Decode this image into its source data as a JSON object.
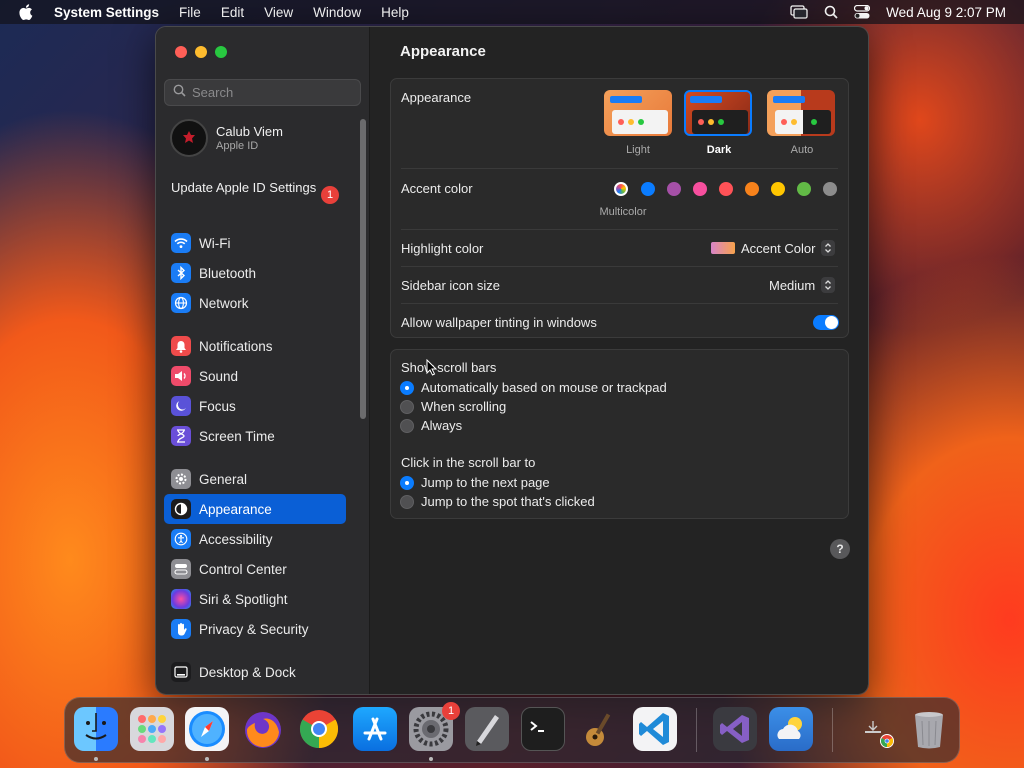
{
  "menubar": {
    "app_name": "System Settings",
    "items": [
      "File",
      "Edit",
      "View",
      "Window",
      "Help"
    ],
    "clock": "Wed Aug 9  2:07 PM"
  },
  "sidebar": {
    "search_placeholder": "Search",
    "user_name": "Calub Viem",
    "user_sub": "Apple ID",
    "update_label": "Update Apple ID Settings",
    "update_badge": "1",
    "items": [
      {
        "label": "Wi-Fi",
        "icon": "wifi-icon",
        "color": "#1a7cf5"
      },
      {
        "label": "Bluetooth",
        "icon": "bluetooth-icon",
        "color": "#1a7cf5"
      },
      {
        "label": "Network",
        "icon": "globe-icon",
        "color": "#1a7cf5"
      },
      {
        "label": "Notifications",
        "icon": "bell-icon",
        "color": "#ef4b4b"
      },
      {
        "label": "Sound",
        "icon": "speaker-icon",
        "color": "#ef4b6a"
      },
      {
        "label": "Focus",
        "icon": "moon-icon",
        "color": "#5a52d8"
      },
      {
        "label": "Screen Time",
        "icon": "hourglass-icon",
        "color": "#6a4fd8"
      },
      {
        "label": "General",
        "icon": "gear-icon",
        "color": "#8e8e93"
      },
      {
        "label": "Appearance",
        "icon": "appearance-icon",
        "color": "#1c1c1e"
      },
      {
        "label": "Accessibility",
        "icon": "accessibility-icon",
        "color": "#1a7cf5"
      },
      {
        "label": "Control Center",
        "icon": "control-center-icon",
        "color": "#8e8e93"
      },
      {
        "label": "Siri & Spotlight",
        "icon": "siri-icon",
        "color": "#b04aa8"
      },
      {
        "label": "Privacy & Security",
        "icon": "hand-icon",
        "color": "#1a7cf5"
      },
      {
        "label": "Desktop & Dock",
        "icon": "desktop-icon",
        "color": "#1c1c1e"
      }
    ]
  },
  "main": {
    "title": "Appearance",
    "appearance_label": "Appearance",
    "appearance_options": [
      "Light",
      "Dark",
      "Auto"
    ],
    "appearance_selected": "Dark",
    "accent_label": "Accent color",
    "accent_caption": "Multicolor",
    "accent_colors": [
      "#ff8a3c",
      "#0a7cff",
      "#a550a7",
      "#f74f9e",
      "#ff5257",
      "#f7821b",
      "#ffc600",
      "#62ba46",
      "#8c8c8c"
    ],
    "highlight_label": "Highlight color",
    "highlight_value": "Accent Color",
    "sidebar_size_label": "Sidebar icon size",
    "sidebar_size_value": "Medium",
    "tinting_label": "Allow wallpaper tinting in windows",
    "tinting_on": true,
    "scroll_label": "Show scroll bars",
    "scroll_options": [
      "Automatically based on mouse or trackpad",
      "When scrolling",
      "Always"
    ],
    "scroll_selected": 0,
    "click_label": "Click in the scroll bar to",
    "click_options": [
      "Jump to the next page",
      "Jump to the spot that's clicked"
    ],
    "click_selected": 0,
    "help_symbol": "?"
  },
  "dock": {
    "settings_badge": "1",
    "apps": [
      "finder",
      "launchpad",
      "safari",
      "firefox",
      "chrome",
      "app-store",
      "system-settings",
      "script-editor",
      "terminal",
      "instruments",
      "vscode",
      "visual-studio",
      "weather",
      "downloads",
      "trash"
    ]
  }
}
